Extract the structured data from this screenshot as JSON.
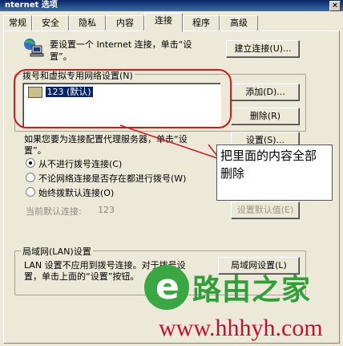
{
  "window": {
    "title": "nternet 选项",
    "close_glyph": "×"
  },
  "tabs": [
    "常规",
    "安全",
    "隐私",
    "内容",
    "连接",
    "程序",
    "高级"
  ],
  "active_tab": "连接",
  "setup": {
    "text_line1": "要设置一个 Internet 连接，单击“设",
    "text_line2": "置”。",
    "button": "建立连接(U)..."
  },
  "dialup": {
    "group_label": "拨号和虚拟专用网络设置(N)",
    "items": [
      "123 (默认)"
    ],
    "add_button": "添加(D)...",
    "remove_button": "删除(R)",
    "settings_button": "设置(S)..."
  },
  "proxy_text": {
    "line1": "如果您要为连接配置代理服务器，单击“设",
    "line2": "置”。"
  },
  "radios": [
    {
      "label": "从不进行拨号连接(C)",
      "checked": true
    },
    {
      "label": "不论网络连接是否存在都进行拨号(W)",
      "checked": false
    },
    {
      "label": "始终拨默认连接(O)",
      "checked": false
    }
  ],
  "default_conn": {
    "label": "当前默认连接:",
    "value": "123",
    "button": "设置默认值(E)"
  },
  "lan": {
    "group_label": "局域网(LAN)设置",
    "line1": "LAN 设置不应用到拨号连接。对于拨号设",
    "line2": "置，单击上面的“设置”按钮。",
    "button": "局域网设置(L)"
  },
  "annotation": {
    "text_line1": "把里面的内容全部",
    "text_line2": "删除",
    "color": "#d21a1a"
  },
  "watermark": {
    "brand": "路由之家",
    "url": "www.hhhyh.com",
    "colors": {
      "green": "#2f9e3b",
      "red": "#c8102e"
    }
  }
}
